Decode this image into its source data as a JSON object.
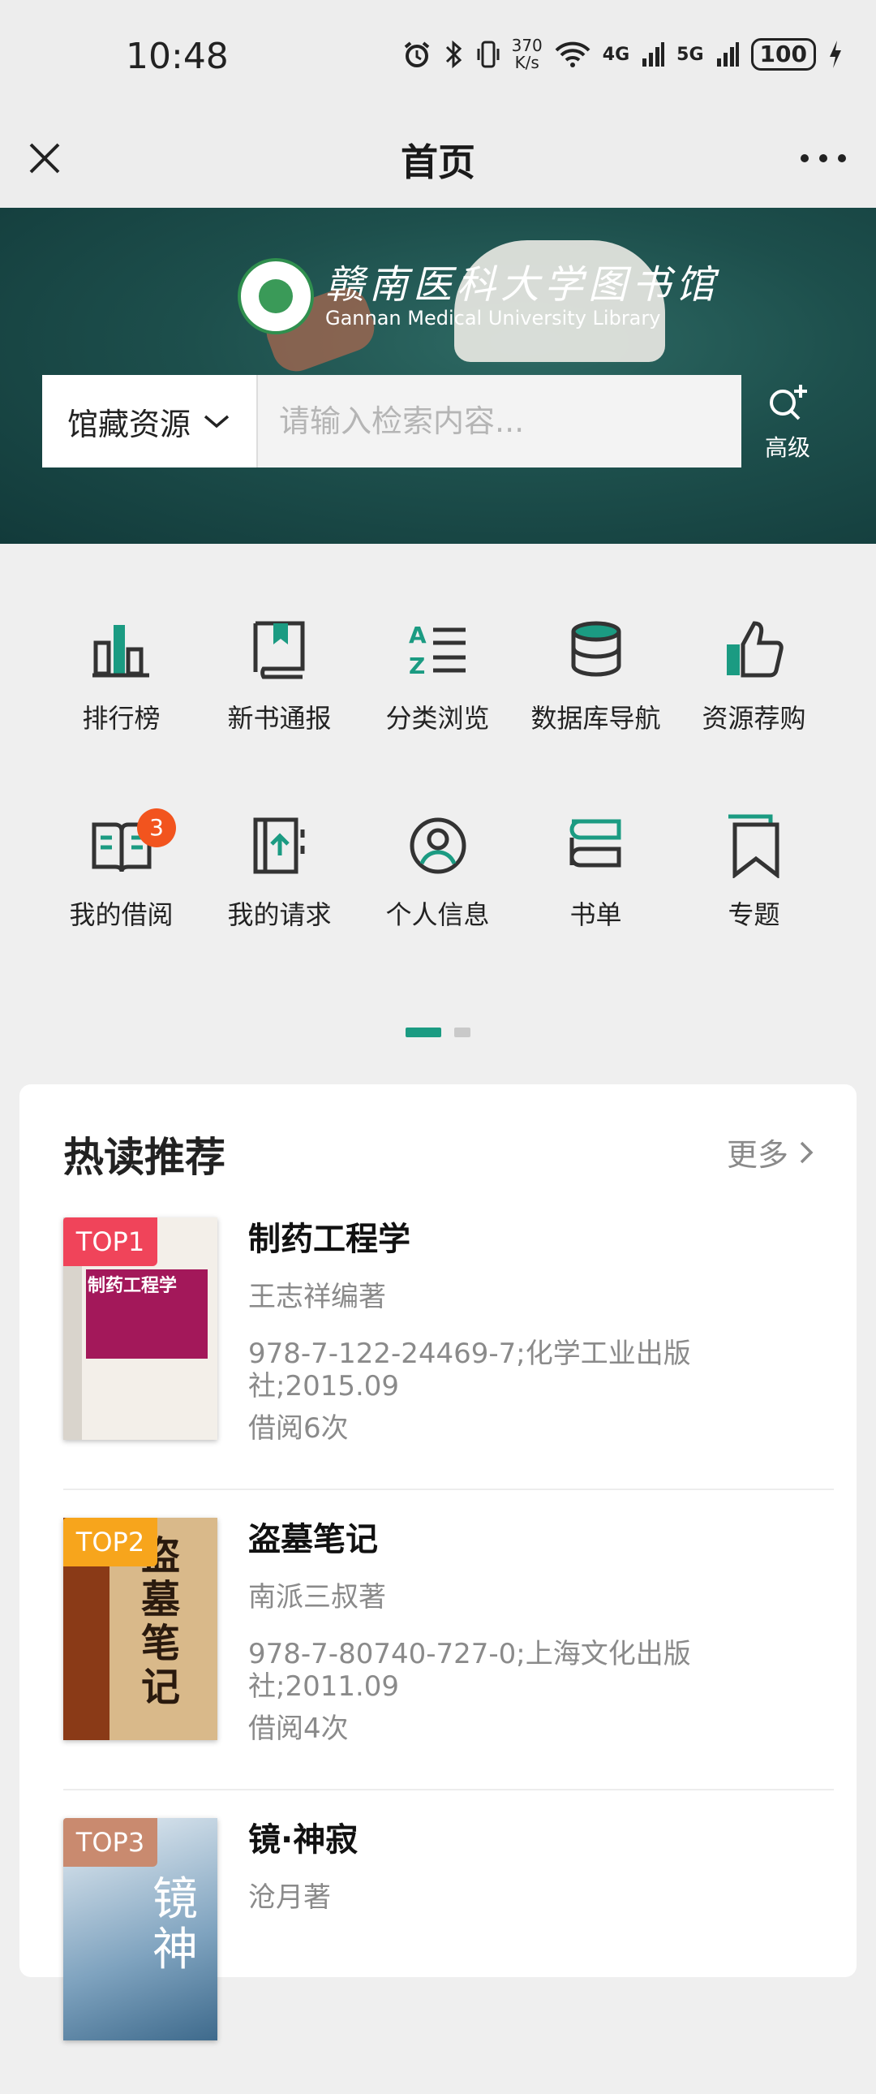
{
  "status_bar": {
    "time": "10:48",
    "speed_top": "370",
    "speed_bottom": "K/s",
    "net1": "4G",
    "net2": "5G",
    "battery": "100"
  },
  "header": {
    "title": "首页"
  },
  "banner": {
    "logo_cn": "赣南医科大学图书馆",
    "logo_en": "Gannan Medical University Library",
    "scope_label": "馆藏资源",
    "search_placeholder": "请输入检索内容...",
    "advanced_label": "高级"
  },
  "menu": {
    "row1": [
      {
        "label": "排行榜",
        "icon": "ranking-icon"
      },
      {
        "label": "新书通报",
        "icon": "new-book-icon"
      },
      {
        "label": "分类浏览",
        "icon": "category-list-icon"
      },
      {
        "label": "数据库导航",
        "icon": "database-icon"
      },
      {
        "label": "资源荐购",
        "icon": "thumbs-up-icon"
      }
    ],
    "row2": [
      {
        "label": "我的借阅",
        "icon": "open-book-icon",
        "badge": "3"
      },
      {
        "label": "我的请求",
        "icon": "request-icon"
      },
      {
        "label": "个人信息",
        "icon": "user-icon"
      },
      {
        "label": "书单",
        "icon": "book-list-icon"
      },
      {
        "label": "专题",
        "icon": "bookmark-icon"
      }
    ]
  },
  "hot": {
    "title": "热读推荐",
    "more": "更多",
    "books": [
      {
        "rank": "TOP1",
        "title": "制药工程学",
        "author": "王志祥编著",
        "pub": "978-7-122-24469-7;化学工业出版社;2015.09",
        "loans": "借阅6次",
        "cover_title": "制药工程学"
      },
      {
        "rank": "TOP2",
        "title": "盗墓笔记",
        "author": "南派三叔著",
        "pub": "978-7-80740-727-0;上海文化出版社;2011.09",
        "loans": "借阅4次",
        "cover_title": "盗墓笔记"
      },
      {
        "rank": "TOP3",
        "title": "镜·神寂",
        "author": "沧月著",
        "pub": "",
        "loans": "",
        "cover_title": "镜神"
      }
    ]
  },
  "colors": {
    "accent": "#1b9b82",
    "top1": "#f0445a",
    "top2": "#f7a51c",
    "top3": "#c98a6f",
    "badge": "#f2541e"
  }
}
